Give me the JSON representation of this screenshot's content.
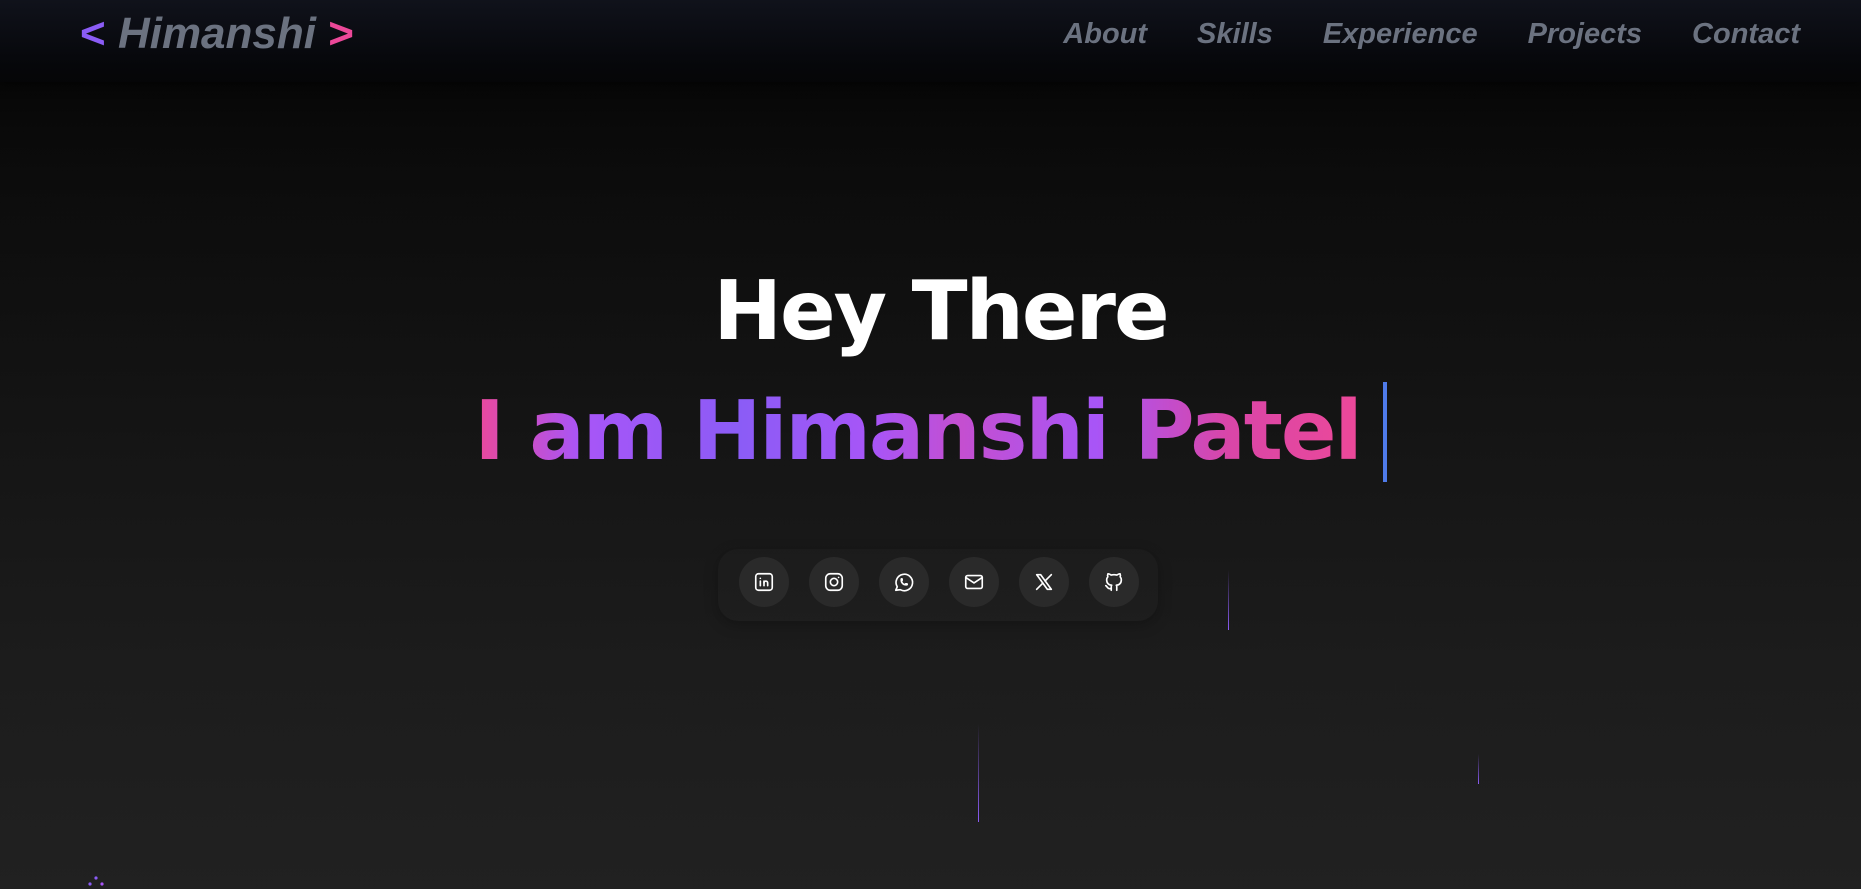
{
  "header": {
    "logo": {
      "open": "<",
      "name": "Himanshi",
      "close": ">"
    },
    "nav": [
      "About",
      "Skills",
      "Experience",
      "Projects",
      "Contact"
    ]
  },
  "hero": {
    "greeting": "Hey There",
    "intro": "I am Himanshi Patel"
  },
  "social": [
    {
      "name": "linkedin",
      "icon": "linkedin-icon"
    },
    {
      "name": "instagram",
      "icon": "instagram-icon"
    },
    {
      "name": "whatsapp",
      "icon": "whatsapp-icon"
    },
    {
      "name": "email",
      "icon": "mail-icon"
    },
    {
      "name": "x",
      "icon": "x-icon"
    },
    {
      "name": "github",
      "icon": "github-icon"
    }
  ],
  "colors": {
    "background_dark": "#030303",
    "background_light": "#212121",
    "accent_purple": "#8b5cf6",
    "accent_pink": "#ec4899",
    "caret_blue": "#4f7bea",
    "nav_text": "#6b7280",
    "icon_bg": "#2a2a2a"
  }
}
